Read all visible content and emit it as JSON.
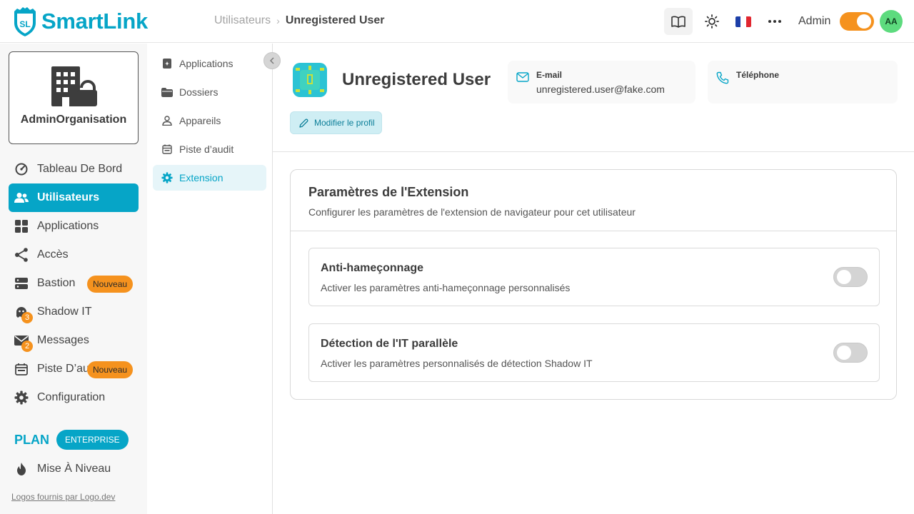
{
  "app": {
    "logo_badge": "SL",
    "name": "SmartLink"
  },
  "breadcrumb": {
    "parent": "Utilisateurs",
    "separator": "›",
    "current": "Unregistered User"
  },
  "header": {
    "icons": [
      "book-icon",
      "sun-icon",
      "french-flag-icon",
      "more-dots-icon"
    ],
    "role_label": "Admin",
    "role_toggle_on": true,
    "avatar_initials": "AA",
    "colors": {
      "accent": "#06a5c7",
      "toggle_on": "#f5921e",
      "avatar_bg": "#5ddb7e"
    }
  },
  "organisation": {
    "name": "AdminOrganisation",
    "icon": "building-lock-icon"
  },
  "sidebar": {
    "items": [
      {
        "label": "Tableau De Bord",
        "icon": "dashboard-gauge-icon",
        "active": false
      },
      {
        "label": "Utilisateurs",
        "icon": "users-icon",
        "active": true
      },
      {
        "label": "Applications",
        "icon": "grid-apps-icon",
        "active": false
      },
      {
        "label": "Accès",
        "icon": "share-icon",
        "active": false
      },
      {
        "label": "Bastion",
        "icon": "server-icon",
        "active": false,
        "badge": "Nouveau"
      },
      {
        "label": "Shadow IT",
        "icon": "ghost-icon",
        "active": false,
        "count": "3"
      },
      {
        "label": "Messages",
        "icon": "envelope-icon",
        "active": false,
        "count": "2"
      },
      {
        "label": "Piste D’au",
        "icon": "calendar-icon",
        "active": false,
        "badge": "Nouveau"
      },
      {
        "label": "Configuration",
        "icon": "gear-icon",
        "active": false
      }
    ],
    "plan_label": "PLAN",
    "plan_value": "ENTERPRISE",
    "upgrade": {
      "label": "Mise À Niveau",
      "icon": "flame-icon"
    },
    "credit": "Logos fournis par Logo.dev"
  },
  "subnav": {
    "items": [
      {
        "label": "Applications",
        "icon": "app-square-icon",
        "active": false
      },
      {
        "label": "Dossiers",
        "icon": "folder-icon",
        "active": false
      },
      {
        "label": "Appareils",
        "icon": "person-icon",
        "active": false
      },
      {
        "label": "Piste d’audit",
        "icon": "calendar-icon",
        "active": false
      },
      {
        "label": "Extension",
        "icon": "gear-icon",
        "active": true
      }
    ]
  },
  "profile": {
    "name": "Unregistered User",
    "email_label": "E-mail",
    "email": "unregistered.user@fake.com",
    "phone_label": "Téléphone",
    "phone": "",
    "edit_label": "Modifier le profil"
  },
  "extension_card": {
    "title": "Paramètres de l'Extension",
    "subtitle": "Configurer les paramètres de l'extension de navigateur pour cet utilisateur",
    "settings": [
      {
        "title": "Anti-hameçonnage",
        "description": "Activer les paramètres anti-hameçonnage personnalisés",
        "enabled": false
      },
      {
        "title": "Détection de l'IT parallèle",
        "description": "Activer les paramètres personnalisés de détection Shadow IT",
        "enabled": false
      }
    ]
  }
}
